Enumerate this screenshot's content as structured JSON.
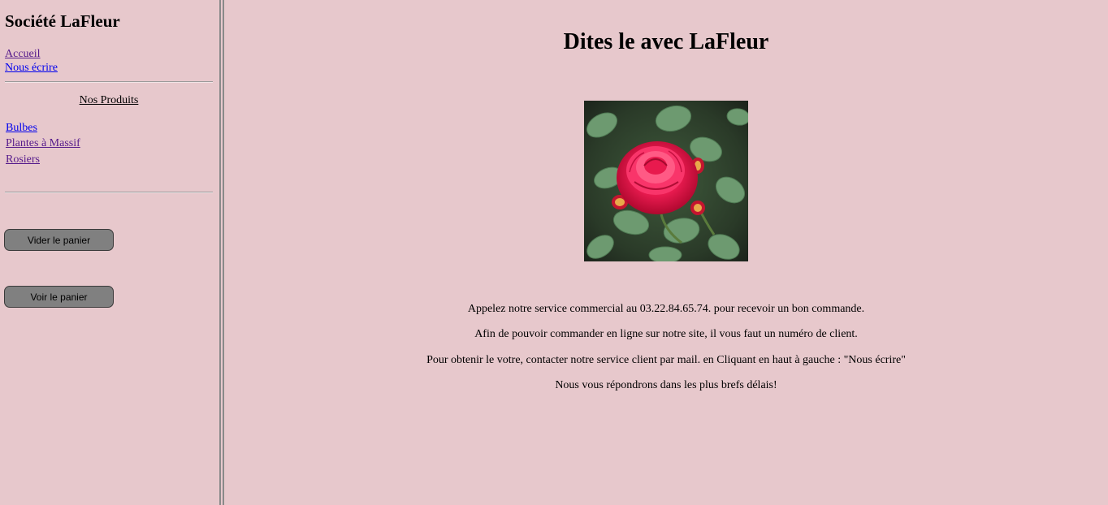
{
  "sidebar": {
    "title": "Société LaFleur",
    "nav": {
      "home": "Accueil",
      "contact": "Nous écrire"
    },
    "products_heading": "Nos Produits",
    "products": [
      "Bulbes",
      "Plantes à Massif",
      "Rosiers"
    ],
    "buttons": {
      "empty_cart": "Vider le panier",
      "view_cart": "Voir le panier"
    }
  },
  "main": {
    "title": "Dites le avec LaFleur",
    "image_icon": "rose-photo",
    "paragraphs": [
      "Appelez notre service commercial au 03.22.84.65.74. pour recevoir un bon commande.",
      "Afin de pouvoir commander en ligne sur notre site, il vous faut un numéro de client.",
      "Pour obtenir le votre, contacter notre service client par mail. en Cliquant en haut à gauche : \"Nous écrire\"",
      "Nous vous répondrons dans les plus brefs délais!"
    ]
  },
  "colors": {
    "background": "#e7c8cc",
    "visited_link": "#551a8b",
    "link": "#0000ee",
    "button": "#808080"
  }
}
